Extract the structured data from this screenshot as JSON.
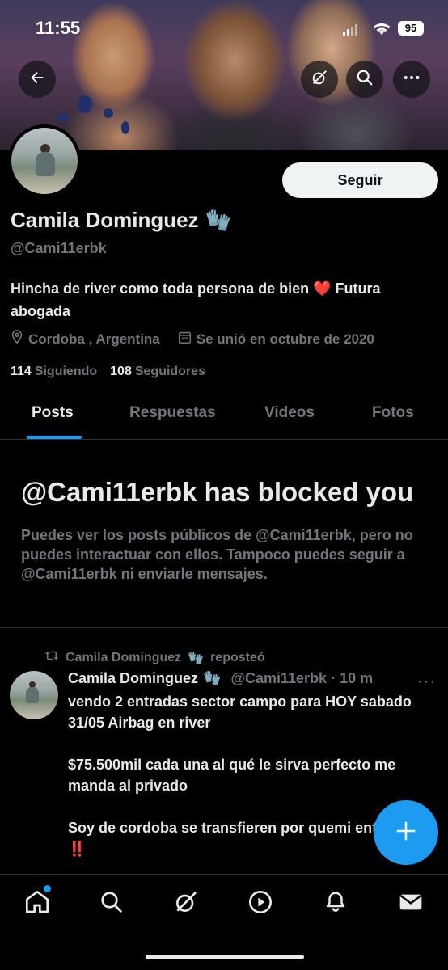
{
  "status_bar": {
    "time": "11:55",
    "battery": "95"
  },
  "profile": {
    "follow_label": "Seguir",
    "name": "Camila Dominguez",
    "name_emoji": "🧤",
    "handle": "@Cami11erbk",
    "bio": "Hincha de river como toda persona de bien ❤️ Futura abogada",
    "location": "Cordoba , Argentina",
    "joined": "Se unió en octubre de 2020",
    "following_count": "114",
    "following_label": "Siguiendo",
    "followers_count": "108",
    "followers_label": "Seguidores"
  },
  "tabs": [
    {
      "label": "Posts"
    },
    {
      "label": "Respuestas"
    },
    {
      "label": "Videos"
    },
    {
      "label": "Fotos"
    }
  ],
  "blocked": {
    "title": "@Cami11erbk has blocked you",
    "description": "Puedes ver los posts públicos de @Cami11erbk, pero no puedes interactuar con ellos. Tampoco puedes seguir a @Cami11erbk ni enviarle mensajes."
  },
  "post": {
    "repost_by": "Camila Dominguez",
    "repost_emoji": "🧤",
    "repost_label": "reposteó",
    "author": "Camila Dominguez",
    "author_emoji": "🧤",
    "handle_time": "@Cami11erbk · 10 m",
    "paragraph1": "vendo 2 entradas sector campo para HOY sabado 31/05 Airbag en river",
    "paragraph2": "$75.500mil cada una al qué le sirva perfecto me manda al privado",
    "paragraph3": "Soy de cordoba se transfieren por quemi entradas ‼️"
  },
  "icons": {
    "back": "arrow-left-icon",
    "grok": "grok-icon",
    "search": "search-icon",
    "more": "more-icon",
    "location": "location-pin-icon",
    "calendar": "calendar-icon",
    "repost": "repost-icon",
    "compose": "plus-icon",
    "nav": [
      "home-icon",
      "search-icon",
      "grok-icon",
      "play-icon",
      "bell-icon",
      "mail-icon"
    ]
  },
  "colors": {
    "accent": "#1d9bf0",
    "muted": "#71767b",
    "text": "#e7e9ea"
  }
}
